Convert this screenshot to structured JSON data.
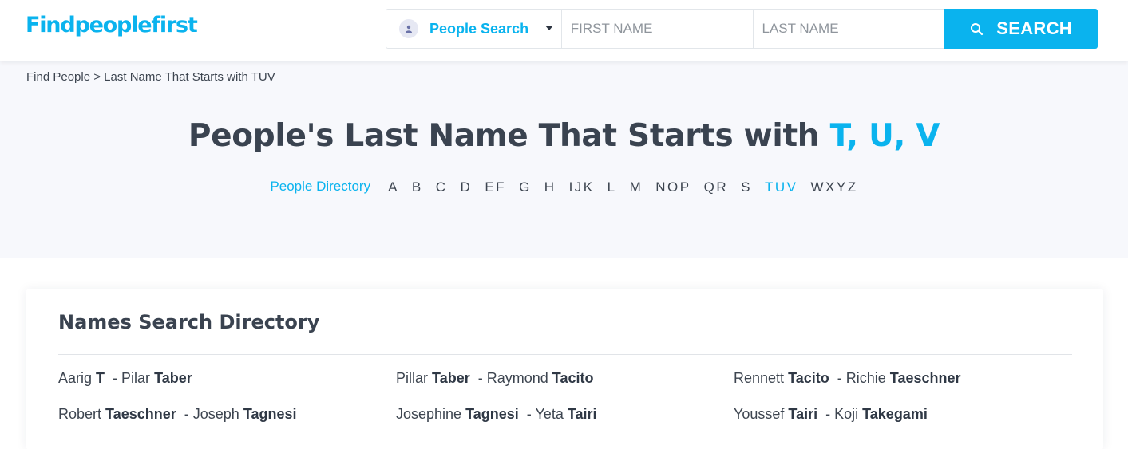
{
  "header": {
    "logo": "Findpeoplefirst",
    "search_type": "People Search",
    "first_name_placeholder": "FIRST NAME",
    "last_name_placeholder": "LAST NAME",
    "search_button": "SEARCH",
    "accent_color": "#0ab3ee"
  },
  "breadcrumb": {
    "root": "Find People",
    "separator": ">",
    "current": "Last Name That Starts with TUV"
  },
  "hero": {
    "title_prefix": "People's Last Name That Starts with ",
    "title_highlight": "T, U, V",
    "directory_link": "People Directory",
    "letters": [
      "A",
      "B",
      "C",
      "D",
      "EF",
      "G",
      "H",
      "IJK",
      "L",
      "M",
      "NOP",
      "QR",
      "S",
      "TUV",
      "WXYZ"
    ],
    "active_letter": "TUV"
  },
  "directory": {
    "title": "Names Search Directory",
    "rows": [
      [
        {
          "a_first": "Aarig",
          "a_last": "T",
          "b_first": "Pilar",
          "b_last": "Taber"
        },
        {
          "a_first": "Pillar",
          "a_last": "Taber",
          "b_first": "Raymond",
          "b_last": "Tacito"
        },
        {
          "a_first": "Rennett",
          "a_last": "Tacito",
          "b_first": "Richie",
          "b_last": "Taeschner"
        }
      ],
      [
        {
          "a_first": "Robert",
          "a_last": "Taeschner",
          "b_first": "Joseph",
          "b_last": "Tagnesi"
        },
        {
          "a_first": "Josephine",
          "a_last": "Tagnesi",
          "b_first": "Yeta",
          "b_last": "Tairi"
        },
        {
          "a_first": "Youssef",
          "a_last": "Tairi",
          "b_first": "Koji",
          "b_last": "Takegami"
        }
      ]
    ]
  }
}
